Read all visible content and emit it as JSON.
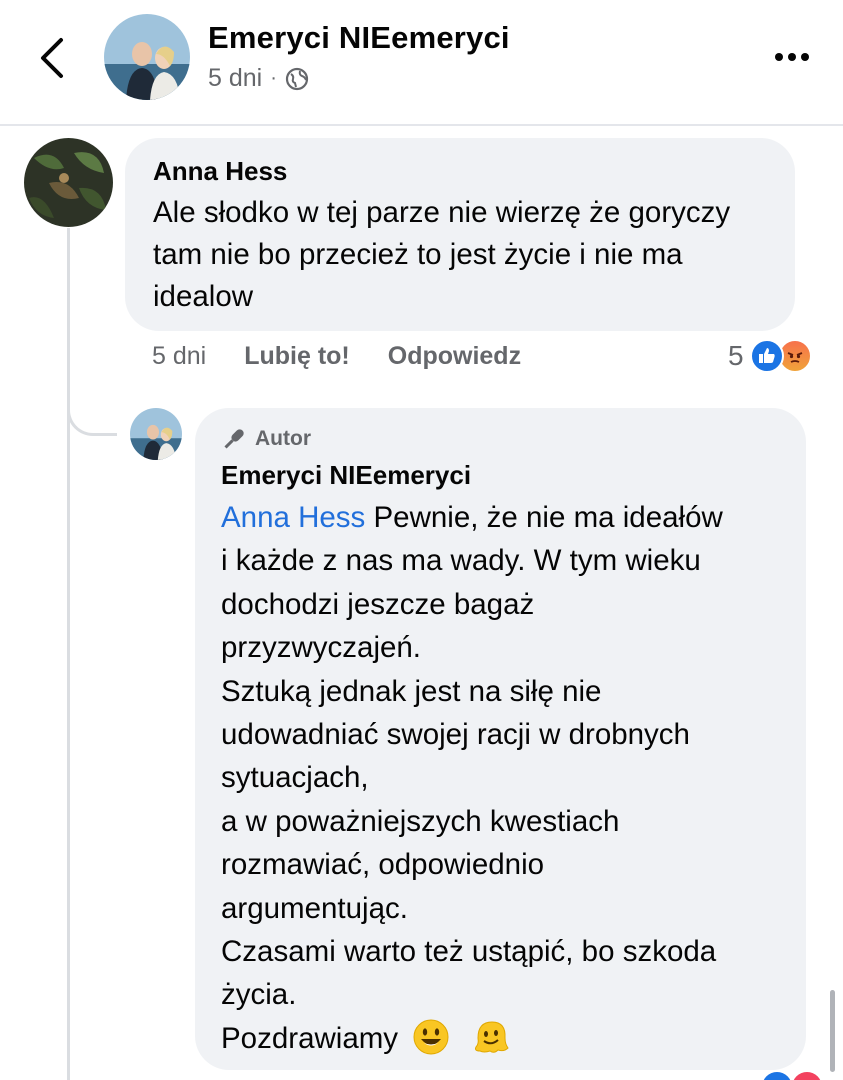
{
  "header": {
    "page_name": "Emeryci NIEemeryci",
    "time": "5 dni",
    "dot": "·",
    "back_icon": "chevron-left-icon",
    "privacy_icon": "globe-icon",
    "more_icon": "more-horizontal-icon"
  },
  "comment": {
    "author": "Anna Hess",
    "text": "Ale słodko w tej parze nie wierzę że goryczy tam nie bo przecież to jest życie i nie ma idealow",
    "time": "5 dni",
    "like_label": "Lubię to!",
    "reply_label": "Odpowiedz",
    "reaction_count": "5",
    "reactions": [
      "like",
      "angry"
    ]
  },
  "reply": {
    "badge": "Autor",
    "author": "Emeryci NIEemeryci",
    "mention": "Anna Hess",
    "lines": [
      " Pewnie, że nie ma ideałów",
      "i każde z nas ma wady. W tym wieku",
      "dochodzi jeszcze bagaż",
      "przyzwyczajeń.",
      "Sztuką jednak  jest na siłę nie",
      "udowadniać swojej racji w drobnych",
      "sytuacjach,",
      "a w poważniejszych kwestiach",
      "rozmawiać, odpowiednio",
      "argumentując.",
      "Czasami warto też ustąpić, bo szkoda",
      "życia.",
      "Pozdrawiamy"
    ],
    "emojis": [
      "smiley-emoji",
      "melting-face-emoji"
    ]
  },
  "colors": {
    "bubble": "#f0f2f5",
    "mention": "#216fdb",
    "secondary_text": "#65676b",
    "like_blue": "#1b74e4"
  }
}
